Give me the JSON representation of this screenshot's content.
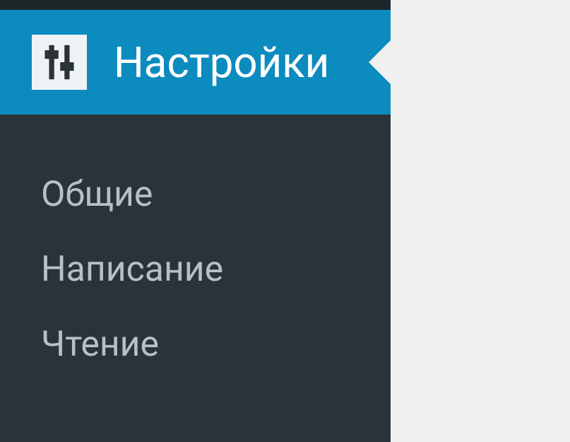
{
  "sidebar": {
    "header_label": "Настройки",
    "items": [
      {
        "label": "Общие"
      },
      {
        "label": "Написание"
      },
      {
        "label": "Чтение"
      }
    ]
  }
}
